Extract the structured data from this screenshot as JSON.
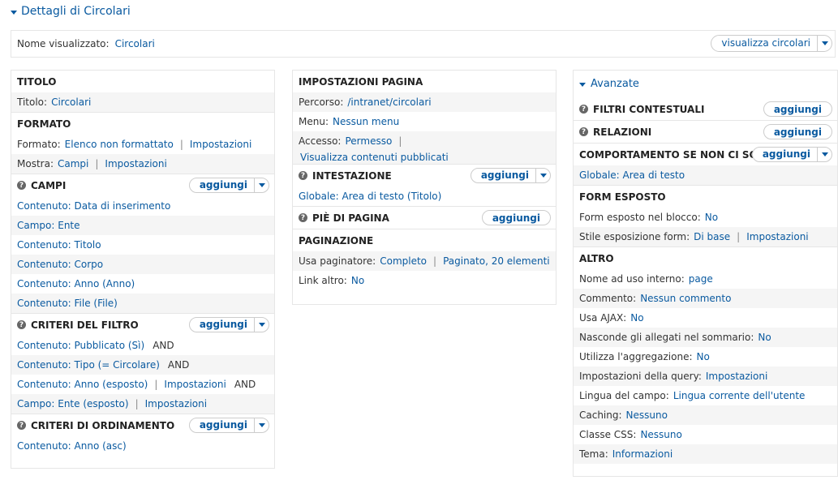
{
  "title": "Dettagli di Circolari",
  "namebar": {
    "label": "Nome visualizzato:",
    "value": "Circolari",
    "button": "visualizza circolari"
  },
  "col1": {
    "titolo_header": "TITOLO",
    "titolo_label": "Titolo:",
    "titolo_value": "Circolari",
    "formato_header": "FORMATO",
    "formato_label": "Formato:",
    "formato_value": "Elenco non formattato",
    "formato_settings": "Impostazioni",
    "mostra_label": "Mostra:",
    "mostra_value": "Campi",
    "mostra_settings": "Impostazioni",
    "campi_header": "CAMPI",
    "campi_add": "aggiungi",
    "campi": [
      "Contenuto: Data di inserimento",
      "Campo: Ente",
      "Contenuto: Titolo",
      "Contenuto: Corpo",
      "Contenuto: Anno (Anno)",
      "Contenuto: File (File)"
    ],
    "filtri_header": "CRITERI DEL FILTRO",
    "filtri_add": "aggiungi",
    "filtri": [
      {
        "text": "Contenuto: Pubblicato (Sì)",
        "and": "AND"
      },
      {
        "text": "Contenuto: Tipo (= Circolare)",
        "and": "AND"
      },
      {
        "text": "Contenuto: Anno (esposto)",
        "settings": "Impostazioni",
        "and": "AND"
      },
      {
        "text": "Campo: Ente (esposto)",
        "settings": "Impostazioni"
      }
    ],
    "ordinamento_header": "CRITERI DI ORDINAMENTO",
    "ordinamento_add": "aggiungi",
    "ordinamento": [
      "Contenuto: Anno (asc)"
    ]
  },
  "col2": {
    "page_header": "IMPOSTAZIONI PAGINA",
    "percorso_label": "Percorso:",
    "percorso_value": "/intranet/circolari",
    "menu_label": "Menu:",
    "menu_value": "Nessun menu",
    "accesso_label": "Accesso:",
    "accesso_value": "Permesso",
    "accesso_value2": "Visualizza contenuti pubblicati",
    "intestazione_header": "INTESTAZIONE",
    "intestazione_add": "aggiungi",
    "intestazione_item": "Globale: Area di testo (Titolo)",
    "piede_header": "PIÈ DI PAGINA",
    "piede_add": "aggiungi",
    "paginazione_header": "PAGINAZIONE",
    "pager_label": "Usa paginatore:",
    "pager_value": "Completo",
    "pager_value2": "Paginato, 20 elementi",
    "link_label": "Link altro:",
    "link_value": "No"
  },
  "col3": {
    "avanzate": "Avanzate",
    "contestuali_header": "FILTRI CONTESTUALI",
    "contestuali_add": "aggiungi",
    "relazioni_header": "RELAZIONI",
    "relazioni_add": "aggiungi",
    "noresults_header": "COMPORTAMENTO SE NON CI SONO RISULTATI",
    "noresults_add": "aggiungi",
    "noresults_item": "Globale: Area di testo",
    "form_header": "FORM ESPOSTO",
    "form_block_label": "Form esposto nel blocco:",
    "form_block_value": "No",
    "form_style_label": "Stile esposizione form:",
    "form_style_value": "Di base",
    "form_style_settings": "Impostazioni",
    "altro_header": "ALTRO",
    "altro": [
      {
        "label": "Nome ad uso interno:",
        "value": "page"
      },
      {
        "label": "Commento:",
        "value": "Nessun commento"
      },
      {
        "label": "Usa AJAX:",
        "value": "No"
      },
      {
        "label": "Nasconde gli allegati nel sommario:",
        "value": "No"
      },
      {
        "label": "Utilizza l'aggregazione:",
        "value": "No"
      },
      {
        "label": "Impostazioni della query:",
        "value": "Impostazioni"
      },
      {
        "label": "Lingua del campo:",
        "value": "Lingua corrente dell'utente"
      },
      {
        "label": "Caching:",
        "value": "Nessuno"
      },
      {
        "label": "Classe CSS:",
        "value": "Nessuno"
      },
      {
        "label": "Tema:",
        "value": "Informazioni"
      }
    ]
  }
}
